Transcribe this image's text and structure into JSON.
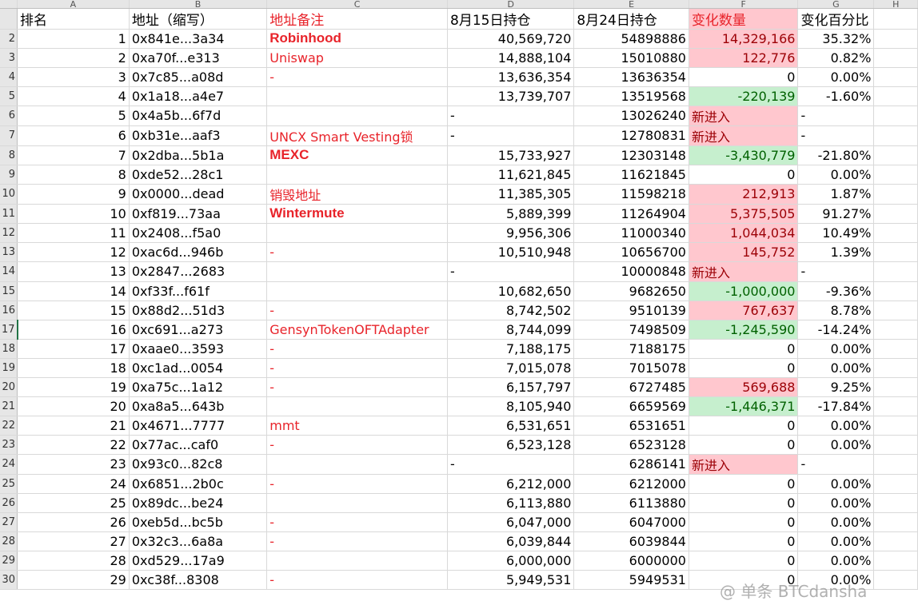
{
  "columns": [
    "A",
    "B",
    "C",
    "D",
    "E",
    "F",
    "G",
    "H"
  ],
  "headers": {
    "rank": "排名",
    "address": "地址（缩写）",
    "note": "地址备注",
    "aug15": "8月15日持仓",
    "aug24": "8月24日持仓",
    "change": "变化数量",
    "pct": "变化百分比"
  },
  "rows": [
    {
      "row": "2",
      "rank": "1",
      "addr": "0x841e...3a34",
      "note": "Robinhood",
      "note_style": "bold",
      "a15": "40,569,720",
      "a24": "54898886",
      "chg": "14,329,166",
      "chg_style": "pos",
      "pct": "35.32%"
    },
    {
      "row": "3",
      "rank": "2",
      "addr": "0xa70f...e313",
      "note": "Uniswap",
      "note_style": "normal",
      "a15": "14,888,104",
      "a24": "15010880",
      "chg": "122,776",
      "chg_style": "pos",
      "pct": "0.82%"
    },
    {
      "row": "4",
      "rank": "3",
      "addr": "0x7c85...a08d",
      "note": "-",
      "note_style": "normal",
      "a15": "13,636,354",
      "a24": "13636354",
      "chg": "0",
      "chg_style": "none",
      "pct": "0.00%"
    },
    {
      "row": "5",
      "rank": "4",
      "addr": "0x1a18...a4e7",
      "note": "",
      "note_style": "normal",
      "a15": "13,739,707",
      "a24": "13519568",
      "chg": "-220,139",
      "chg_style": "neg",
      "pct": "-1.60%"
    },
    {
      "row": "6",
      "rank": "5",
      "addr": "0x4a5b...6f7d",
      "note": "",
      "note_style": "normal",
      "a15": "-",
      "a24": "13026240",
      "chg": "新进入",
      "chg_style": "new",
      "pct": "-"
    },
    {
      "row": "7",
      "rank": "6",
      "addr": "0xb31e...aaf3",
      "note": "UNCX Smart Vesting锁",
      "note_style": "normal",
      "a15": "-",
      "a24": "12780831",
      "chg": "新进入",
      "chg_style": "new",
      "pct": "-"
    },
    {
      "row": "8",
      "rank": "7",
      "addr": "0x2dba...5b1a",
      "note": "MEXC",
      "note_style": "bold",
      "a15": "15,733,927",
      "a24": "12303148",
      "chg": "-3,430,779",
      "chg_style": "neg",
      "pct": "-21.80%"
    },
    {
      "row": "9",
      "rank": "8",
      "addr": "0xde52...28c1",
      "note": "",
      "note_style": "normal",
      "a15": "11,621,845",
      "a24": "11621845",
      "chg": "0",
      "chg_style": "none",
      "pct": "0.00%"
    },
    {
      "row": "10",
      "rank": "9",
      "addr": "0x0000...dead",
      "note": "销毁地址",
      "note_style": "normal",
      "a15": "11,385,305",
      "a24": "11598218",
      "chg": "212,913",
      "chg_style": "pos",
      "pct": "1.87%"
    },
    {
      "row": "11",
      "rank": "10",
      "addr": "0xf819...73aa",
      "note": "Wintermute",
      "note_style": "bold",
      "a15": "5,889,399",
      "a24": "11264904",
      "chg": "5,375,505",
      "chg_style": "pos",
      "pct": "91.27%"
    },
    {
      "row": "12",
      "rank": "11",
      "addr": "0x2408...f5a0",
      "note": "",
      "note_style": "normal",
      "a15": "9,956,306",
      "a24": "11000340",
      "chg": "1,044,034",
      "chg_style": "pos",
      "pct": "10.49%"
    },
    {
      "row": "13",
      "rank": "12",
      "addr": "0xac6d...946b",
      "note": "-",
      "note_style": "normal",
      "a15": "10,510,948",
      "a24": "10656700",
      "chg": "145,752",
      "chg_style": "pos",
      "pct": "1.39%"
    },
    {
      "row": "14",
      "rank": "13",
      "addr": "0x2847...2683",
      "note": "",
      "note_style": "normal",
      "a15": "-",
      "a24": "10000848",
      "chg": "新进入",
      "chg_style": "new",
      "pct": "-"
    },
    {
      "row": "15",
      "rank": "14",
      "addr": "0xf33f...f61f",
      "note": "",
      "note_style": "normal",
      "a15": "10,682,650",
      "a24": "9682650",
      "chg": "-1,000,000",
      "chg_style": "neg",
      "pct": "-9.36%"
    },
    {
      "row": "16",
      "rank": "15",
      "addr": "0x88d2...51d3",
      "note": "-",
      "note_style": "normal",
      "a15": "8,742,502",
      "a24": "9510139",
      "chg": "767,637",
      "chg_style": "pos",
      "pct": "8.78%"
    },
    {
      "row": "17",
      "rank": "16",
      "addr": "0xc691...a273",
      "note": "GensynTokenOFTAdapter",
      "note_style": "normal",
      "a15": "8,744,099",
      "a24": "7498509",
      "chg": "-1,245,590",
      "chg_style": "neg",
      "pct": "-14.24%"
    },
    {
      "row": "18",
      "rank": "17",
      "addr": "0xaae0...3593",
      "note": "-",
      "note_style": "normal",
      "a15": "7,188,175",
      "a24": "7188175",
      "chg": "0",
      "chg_style": "none",
      "pct": "0.00%"
    },
    {
      "row": "19",
      "rank": "18",
      "addr": "0xc1ad...0054",
      "note": "-",
      "note_style": "normal",
      "a15": "7,015,078",
      "a24": "7015078",
      "chg": "0",
      "chg_style": "none",
      "pct": "0.00%"
    },
    {
      "row": "20",
      "rank": "19",
      "addr": "0xa75c...1a12",
      "note": "-",
      "note_style": "normal",
      "a15": "6,157,797",
      "a24": "6727485",
      "chg": "569,688",
      "chg_style": "pos",
      "pct": "9.25%"
    },
    {
      "row": "21",
      "rank": "20",
      "addr": "0xa8a5...643b",
      "note": "",
      "note_style": "normal",
      "a15": "8,105,940",
      "a24": "6659569",
      "chg": "-1,446,371",
      "chg_style": "neg",
      "pct": "-17.84%"
    },
    {
      "row": "22",
      "rank": "21",
      "addr": "0x4671...7777",
      "note": "mmt",
      "note_style": "normal",
      "a15": "6,531,651",
      "a24": "6531651",
      "chg": "0",
      "chg_style": "none",
      "pct": "0.00%"
    },
    {
      "row": "23",
      "rank": "22",
      "addr": "0x77ac...caf0",
      "note": "-",
      "note_style": "normal",
      "a15": "6,523,128",
      "a24": "6523128",
      "chg": "0",
      "chg_style": "none",
      "pct": "0.00%"
    },
    {
      "row": "24",
      "rank": "23",
      "addr": "0x93c0...82c8",
      "note": "",
      "note_style": "normal",
      "a15": "-",
      "a24": "6286141",
      "chg": "新进入",
      "chg_style": "new",
      "pct": "-"
    },
    {
      "row": "25",
      "rank": "24",
      "addr": "0x6851...2b0c",
      "note": "-",
      "note_style": "normal",
      "a15": "6,212,000",
      "a24": "6212000",
      "chg": "0",
      "chg_style": "none",
      "pct": "0.00%"
    },
    {
      "row": "26",
      "rank": "25",
      "addr": "0x89dc...be24",
      "note": "",
      "note_style": "normal",
      "a15": "6,113,880",
      "a24": "6113880",
      "chg": "0",
      "chg_style": "none",
      "pct": "0.00%"
    },
    {
      "row": "27",
      "rank": "26",
      "addr": "0xeb5d...bc5b",
      "note": "-",
      "note_style": "normal",
      "a15": "6,047,000",
      "a24": "6047000",
      "chg": "0",
      "chg_style": "none",
      "pct": "0.00%"
    },
    {
      "row": "28",
      "rank": "27",
      "addr": "0x32c3...6a8a",
      "note": "-",
      "note_style": "normal",
      "a15": "6,039,844",
      "a24": "6039844",
      "chg": "0",
      "chg_style": "none",
      "pct": "0.00%"
    },
    {
      "row": "29",
      "rank": "28",
      "addr": "0xd529...17a9",
      "note": "",
      "note_style": "normal",
      "a15": "6,000,000",
      "a24": "6000000",
      "chg": "0",
      "chg_style": "none",
      "pct": "0.00%"
    },
    {
      "row": "30",
      "rank": "29",
      "addr": "0xc38f...8308",
      "note": "-",
      "note_style": "normal",
      "a15": "5,949,531",
      "a24": "5949531",
      "chg": "0",
      "chg_style": "none",
      "pct": "0.00%"
    }
  ],
  "watermark": "@ 单条 BTCdansha",
  "colors": {
    "positive_bg": "#ffc7ce",
    "negative_bg": "#c6efce",
    "note_red": "#e8232a"
  }
}
